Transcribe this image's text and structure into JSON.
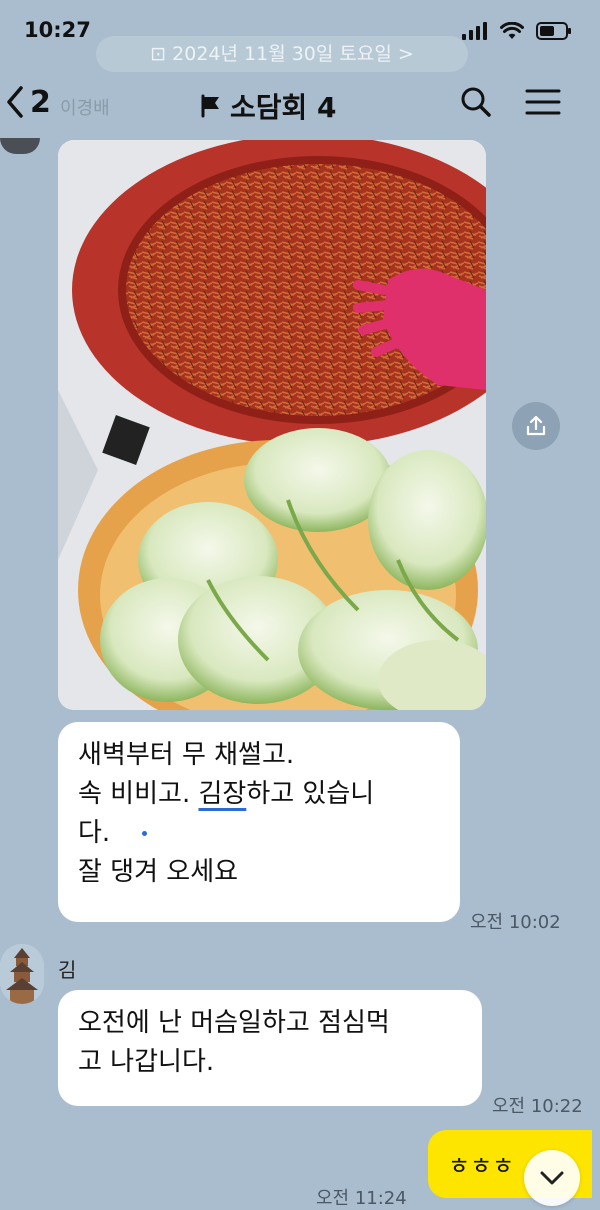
{
  "status": {
    "time": "10:27"
  },
  "date_banner": "⊡ 2024년 11월 30일 토요일 >",
  "header": {
    "back_count": "2",
    "ghost_name": "이경배",
    "title": "소담회 4"
  },
  "messages": [
    {
      "type": "photo"
    },
    {
      "type": "text",
      "lines": [
        "새벽부터 무 채썰고.",
        "속 비비고.",
        "김장",
        "하고 있습니",
        "다.",
        "잘 댕겨 오세요"
      ],
      "time": "오전 10:02"
    },
    {
      "type": "text",
      "sender": "김",
      "lines": [
        "오전에 난 머슴일하고 점심먹",
        "고 나갑니다."
      ],
      "time": "오전 10:22"
    },
    {
      "type": "mine",
      "text": "ㅎㅎㅎ",
      "time": "오전 11:24"
    }
  ],
  "colors": {
    "chat_bg": "#a9bdce",
    "my_bubble": "#fee500",
    "underline": "#2b6cd2"
  }
}
